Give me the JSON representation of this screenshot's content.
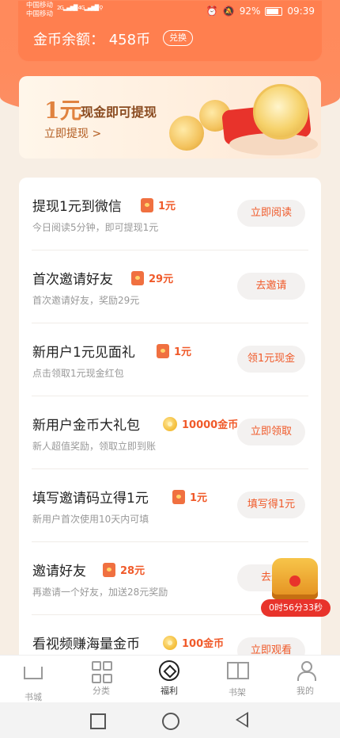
{
  "status_bar": {
    "carrier1": "中国移动",
    "carrier2": "中国移动",
    "net1": "2G",
    "net2": "4G",
    "battery": "92%",
    "time": "09:39"
  },
  "header": {
    "balance": "金币余额：  458币",
    "exchange_label": "兑换"
  },
  "banner": {
    "big_text": "1元",
    "title": "现金即可提现",
    "link": "立即提现 >"
  },
  "tasks": [
    {
      "title": "提现1元到微信",
      "reward": "1元",
      "reward_icon": "red-envelope-icon",
      "subtitle": "今日阅读5分钟，即可提现1元",
      "button": "立即阅读"
    },
    {
      "title": "首次邀请好友",
      "reward": "29元",
      "reward_icon": "red-envelope-icon",
      "subtitle": "首次邀请好友，奖励29元",
      "button": "去邀请"
    },
    {
      "title": "新用户1元见面礼",
      "reward": "1元",
      "reward_icon": "red-envelope-icon",
      "subtitle": "点击领取1元现金红包",
      "button": "领1元现金"
    },
    {
      "title": "新用户金币大礼包",
      "reward": "10000金币",
      "reward_icon": "coin-icon",
      "subtitle": "新人超值奖励，领取立即到账",
      "button": "立即领取"
    },
    {
      "title": "填写邀请码立得1元",
      "reward": "1元",
      "reward_icon": "red-envelope-icon",
      "subtitle": "新用户首次使用10天内可填",
      "button": "填写得1元"
    },
    {
      "title": "邀请好友",
      "reward": "28元",
      "reward_icon": "red-envelope-icon",
      "subtitle": "再邀请一个好友，加送28元奖励",
      "button": "去邀"
    },
    {
      "title": "看视频赚海量金币",
      "reward": "100金币",
      "reward_icon": "coin-icon",
      "subtitle": "",
      "button": "立即观看"
    }
  ],
  "treasure": {
    "timer": "0时56分33秒"
  },
  "tabbar": {
    "items": [
      {
        "label": "书城",
        "icon": "home-icon"
      },
      {
        "label": "分类",
        "icon": "grid-icon"
      },
      {
        "label": "福利",
        "icon": "welfare-icon",
        "active": true
      },
      {
        "label": "书架",
        "icon": "book-icon"
      },
      {
        "label": "我的",
        "icon": "user-icon"
      }
    ]
  },
  "colors": {
    "accent": "#ff8a5c",
    "reward": "#f05a2a"
  }
}
